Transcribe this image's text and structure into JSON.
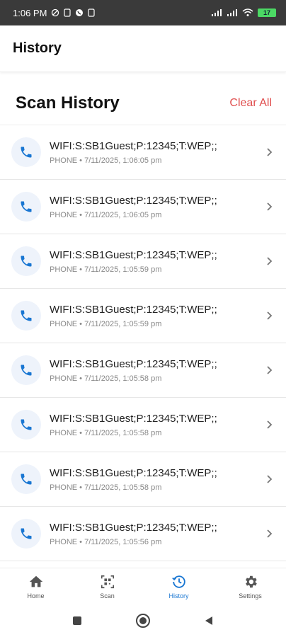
{
  "status_bar": {
    "time": "1:06 PM",
    "battery": "17"
  },
  "app_bar": {
    "title": "History"
  },
  "section": {
    "title": "Scan History",
    "clear_all": "Clear All"
  },
  "history": [
    {
      "title": "WIFI:S:SB1Guest;P:12345;T:WEP;;",
      "subtitle": "PHONE • 7/11/2025, 1:06:05 pm"
    },
    {
      "title": "WIFI:S:SB1Guest;P:12345;T:WEP;;",
      "subtitle": "PHONE • 7/11/2025, 1:06:05 pm"
    },
    {
      "title": "WIFI:S:SB1Guest;P:12345;T:WEP;;",
      "subtitle": "PHONE • 7/11/2025, 1:05:59 pm"
    },
    {
      "title": "WIFI:S:SB1Guest;P:12345;T:WEP;;",
      "subtitle": "PHONE • 7/11/2025, 1:05:59 pm"
    },
    {
      "title": "WIFI:S:SB1Guest;P:12345;T:WEP;;",
      "subtitle": "PHONE • 7/11/2025, 1:05:58 pm"
    },
    {
      "title": "WIFI:S:SB1Guest;P:12345;T:WEP;;",
      "subtitle": "PHONE • 7/11/2025, 1:05:58 pm"
    },
    {
      "title": "WIFI:S:SB1Guest;P:12345;T:WEP;;",
      "subtitle": "PHONE • 7/11/2025, 1:05:58 pm"
    },
    {
      "title": "WIFI:S:SB1Guest;P:12345;T:WEP;;",
      "subtitle": "PHONE • 7/11/2025, 1:05:56 pm"
    }
  ],
  "bottom_nav": [
    {
      "label": "Home",
      "icon": "home-icon"
    },
    {
      "label": "Scan",
      "icon": "qr-scan-icon"
    },
    {
      "label": "History",
      "icon": "history-icon",
      "active": true
    },
    {
      "label": "Settings",
      "icon": "gear-icon"
    }
  ],
  "colors": {
    "accent": "#1976d2",
    "danger": "#e04e4e",
    "status_bar": "#3a3a3a"
  }
}
